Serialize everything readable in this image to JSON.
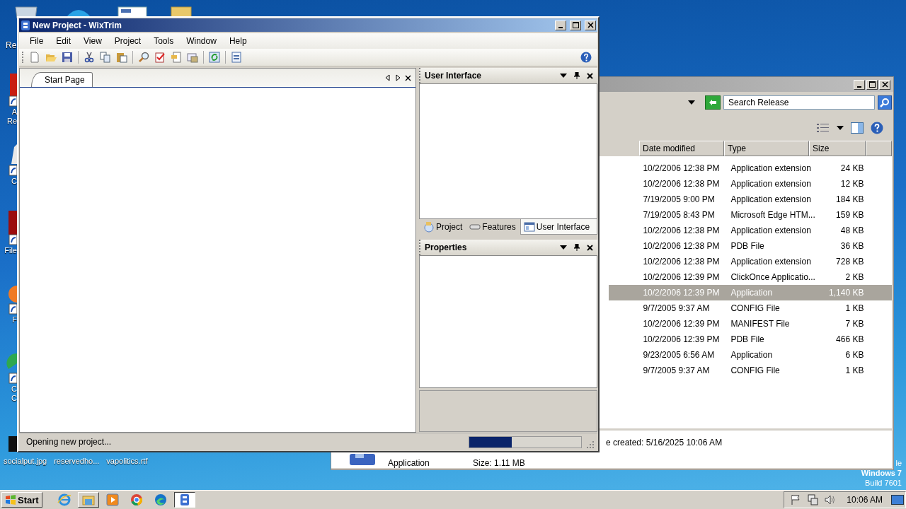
{
  "desktop": {
    "top_label": "Re",
    "left_icons": [
      {
        "lines": [
          "A",
          "Re"
        ],
        "kind": "red"
      },
      {
        "lines": [
          "C"
        ],
        "kind": "plain"
      },
      {
        "lines": [
          "File"
        ],
        "kind": "darkred"
      },
      {
        "lines": [
          "F"
        ],
        "kind": "orange"
      },
      {
        "lines": [
          "C",
          "C"
        ],
        "kind": "chrome"
      }
    ],
    "bottom_icons": [
      "socialput.jpg",
      "reservedho...",
      "vapolitics.rtf"
    ],
    "watermark": [
      "le",
      "Windows 7",
      "Build 7601"
    ]
  },
  "explorer": {
    "search": {
      "placeholder": "Search Release"
    },
    "columns": [
      "Date modified",
      "Type",
      "Size"
    ],
    "rows": [
      {
        "date": "10/2/2006 12:38 PM",
        "type": "Application extension",
        "size": "24 KB",
        "selected": false
      },
      {
        "date": "10/2/2006 12:38 PM",
        "type": "Application extension",
        "size": "12 KB",
        "selected": false
      },
      {
        "date": "7/19/2005 9:00 PM",
        "type": "Application extension",
        "size": "184 KB",
        "selected": false
      },
      {
        "date": "7/19/2005 8:43 PM",
        "type": "Microsoft Edge HTM...",
        "size": "159 KB",
        "selected": false
      },
      {
        "date": "10/2/2006 12:38 PM",
        "type": "Application extension",
        "size": "48 KB",
        "selected": false
      },
      {
        "date": "10/2/2006 12:38 PM",
        "type": "PDB File",
        "size": "36 KB",
        "selected": false
      },
      {
        "date": "10/2/2006 12:38 PM",
        "type": "Application extension",
        "size": "728 KB",
        "selected": false
      },
      {
        "date": "10/2/2006 12:39 PM",
        "type": "ClickOnce Applicatio...",
        "size": "2 KB",
        "selected": false
      },
      {
        "date": "10/2/2006 12:39 PM",
        "type": "Application",
        "size": "1,140 KB",
        "selected": true
      },
      {
        "date": "9/7/2005 9:37 AM",
        "type": "CONFIG File",
        "size": "1 KB",
        "selected": false
      },
      {
        "date": "10/2/2006 12:39 PM",
        "type": "MANIFEST File",
        "size": "7 KB",
        "selected": false
      },
      {
        "date": "10/2/2006 12:39 PM",
        "type": "PDB File",
        "size": "466 KB",
        "selected": false
      },
      {
        "date": "9/23/2005 6:56 AM",
        "type": "Application",
        "size": "6 KB",
        "selected": false
      },
      {
        "date": "9/7/2005 9:37 AM",
        "type": "CONFIG File",
        "size": "1 KB",
        "selected": false
      }
    ],
    "details": {
      "created": "e created: 5/16/2025 10:06 AM",
      "type": "Application",
      "size": "Size: 1.11 MB"
    }
  },
  "wixtrim": {
    "title": "New Project - WixTrim",
    "menu": [
      "File",
      "Edit",
      "View",
      "Project",
      "Tools",
      "Window",
      "Help"
    ],
    "document_tab": "Start Page",
    "explorer_panel": {
      "title": "User Interface",
      "tabs": [
        {
          "label": "Project",
          "kind": "project",
          "selected": false
        },
        {
          "label": "Features",
          "kind": "features",
          "selected": false
        },
        {
          "label": "User Interface",
          "kind": "ui",
          "selected": true
        }
      ]
    },
    "properties_panel": {
      "title": "Properties"
    },
    "status": "Opening new project...",
    "progress": {
      "level": 0.38
    }
  },
  "taskbar": {
    "start": "Start",
    "apps": [
      {
        "kind": "ie",
        "open": false,
        "selected": false
      },
      {
        "kind": "folder",
        "open": true,
        "selected": false
      },
      {
        "kind": "media",
        "open": false,
        "selected": false
      },
      {
        "kind": "chrome",
        "open": false,
        "selected": false
      },
      {
        "kind": "edge",
        "open": false,
        "selected": false
      },
      {
        "kind": "wixtrim",
        "open": true,
        "selected": true
      }
    ],
    "clock": "10:06 AM"
  }
}
